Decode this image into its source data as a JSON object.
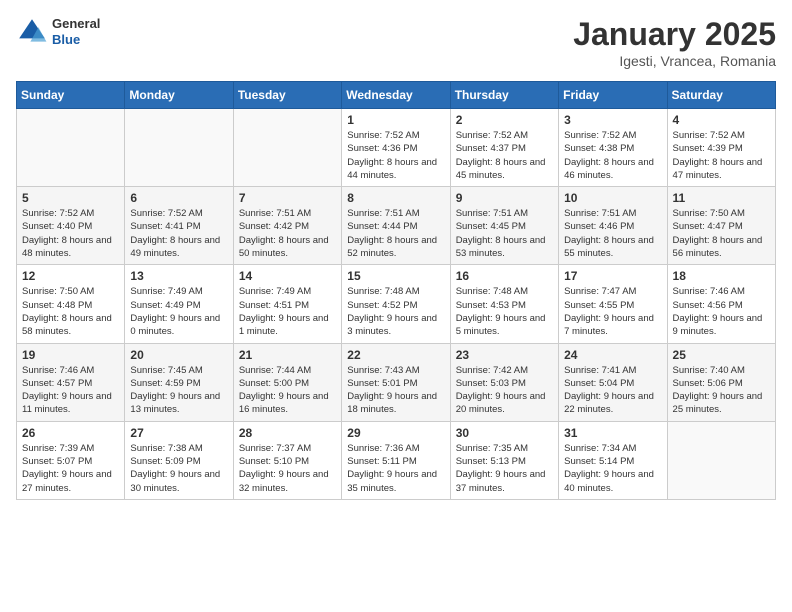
{
  "header": {
    "logo": {
      "general": "General",
      "blue": "Blue"
    },
    "title": "January 2025",
    "subtitle": "Igesti, Vrancea, Romania"
  },
  "calendar": {
    "days_of_week": [
      "Sunday",
      "Monday",
      "Tuesday",
      "Wednesday",
      "Thursday",
      "Friday",
      "Saturday"
    ],
    "weeks": [
      [
        {
          "day": "",
          "info": ""
        },
        {
          "day": "",
          "info": ""
        },
        {
          "day": "",
          "info": ""
        },
        {
          "day": "1",
          "info": "Sunrise: 7:52 AM\nSunset: 4:36 PM\nDaylight: 8 hours\nand 44 minutes."
        },
        {
          "day": "2",
          "info": "Sunrise: 7:52 AM\nSunset: 4:37 PM\nDaylight: 8 hours\nand 45 minutes."
        },
        {
          "day": "3",
          "info": "Sunrise: 7:52 AM\nSunset: 4:38 PM\nDaylight: 8 hours\nand 46 minutes."
        },
        {
          "day": "4",
          "info": "Sunrise: 7:52 AM\nSunset: 4:39 PM\nDaylight: 8 hours\nand 47 minutes."
        }
      ],
      [
        {
          "day": "5",
          "info": "Sunrise: 7:52 AM\nSunset: 4:40 PM\nDaylight: 8 hours\nand 48 minutes."
        },
        {
          "day": "6",
          "info": "Sunrise: 7:52 AM\nSunset: 4:41 PM\nDaylight: 8 hours\nand 49 minutes."
        },
        {
          "day": "7",
          "info": "Sunrise: 7:51 AM\nSunset: 4:42 PM\nDaylight: 8 hours\nand 50 minutes."
        },
        {
          "day": "8",
          "info": "Sunrise: 7:51 AM\nSunset: 4:44 PM\nDaylight: 8 hours\nand 52 minutes."
        },
        {
          "day": "9",
          "info": "Sunrise: 7:51 AM\nSunset: 4:45 PM\nDaylight: 8 hours\nand 53 minutes."
        },
        {
          "day": "10",
          "info": "Sunrise: 7:51 AM\nSunset: 4:46 PM\nDaylight: 8 hours\nand 55 minutes."
        },
        {
          "day": "11",
          "info": "Sunrise: 7:50 AM\nSunset: 4:47 PM\nDaylight: 8 hours\nand 56 minutes."
        }
      ],
      [
        {
          "day": "12",
          "info": "Sunrise: 7:50 AM\nSunset: 4:48 PM\nDaylight: 8 hours\nand 58 minutes."
        },
        {
          "day": "13",
          "info": "Sunrise: 7:49 AM\nSunset: 4:49 PM\nDaylight: 9 hours\nand 0 minutes."
        },
        {
          "day": "14",
          "info": "Sunrise: 7:49 AM\nSunset: 4:51 PM\nDaylight: 9 hours\nand 1 minute."
        },
        {
          "day": "15",
          "info": "Sunrise: 7:48 AM\nSunset: 4:52 PM\nDaylight: 9 hours\nand 3 minutes."
        },
        {
          "day": "16",
          "info": "Sunrise: 7:48 AM\nSunset: 4:53 PM\nDaylight: 9 hours\nand 5 minutes."
        },
        {
          "day": "17",
          "info": "Sunrise: 7:47 AM\nSunset: 4:55 PM\nDaylight: 9 hours\nand 7 minutes."
        },
        {
          "day": "18",
          "info": "Sunrise: 7:46 AM\nSunset: 4:56 PM\nDaylight: 9 hours\nand 9 minutes."
        }
      ],
      [
        {
          "day": "19",
          "info": "Sunrise: 7:46 AM\nSunset: 4:57 PM\nDaylight: 9 hours\nand 11 minutes."
        },
        {
          "day": "20",
          "info": "Sunrise: 7:45 AM\nSunset: 4:59 PM\nDaylight: 9 hours\nand 13 minutes."
        },
        {
          "day": "21",
          "info": "Sunrise: 7:44 AM\nSunset: 5:00 PM\nDaylight: 9 hours\nand 16 minutes."
        },
        {
          "day": "22",
          "info": "Sunrise: 7:43 AM\nSunset: 5:01 PM\nDaylight: 9 hours\nand 18 minutes."
        },
        {
          "day": "23",
          "info": "Sunrise: 7:42 AM\nSunset: 5:03 PM\nDaylight: 9 hours\nand 20 minutes."
        },
        {
          "day": "24",
          "info": "Sunrise: 7:41 AM\nSunset: 5:04 PM\nDaylight: 9 hours\nand 22 minutes."
        },
        {
          "day": "25",
          "info": "Sunrise: 7:40 AM\nSunset: 5:06 PM\nDaylight: 9 hours\nand 25 minutes."
        }
      ],
      [
        {
          "day": "26",
          "info": "Sunrise: 7:39 AM\nSunset: 5:07 PM\nDaylight: 9 hours\nand 27 minutes."
        },
        {
          "day": "27",
          "info": "Sunrise: 7:38 AM\nSunset: 5:09 PM\nDaylight: 9 hours\nand 30 minutes."
        },
        {
          "day": "28",
          "info": "Sunrise: 7:37 AM\nSunset: 5:10 PM\nDaylight: 9 hours\nand 32 minutes."
        },
        {
          "day": "29",
          "info": "Sunrise: 7:36 AM\nSunset: 5:11 PM\nDaylight: 9 hours\nand 35 minutes."
        },
        {
          "day": "30",
          "info": "Sunrise: 7:35 AM\nSunset: 5:13 PM\nDaylight: 9 hours\nand 37 minutes."
        },
        {
          "day": "31",
          "info": "Sunrise: 7:34 AM\nSunset: 5:14 PM\nDaylight: 9 hours\nand 40 minutes."
        },
        {
          "day": "",
          "info": ""
        }
      ]
    ]
  }
}
